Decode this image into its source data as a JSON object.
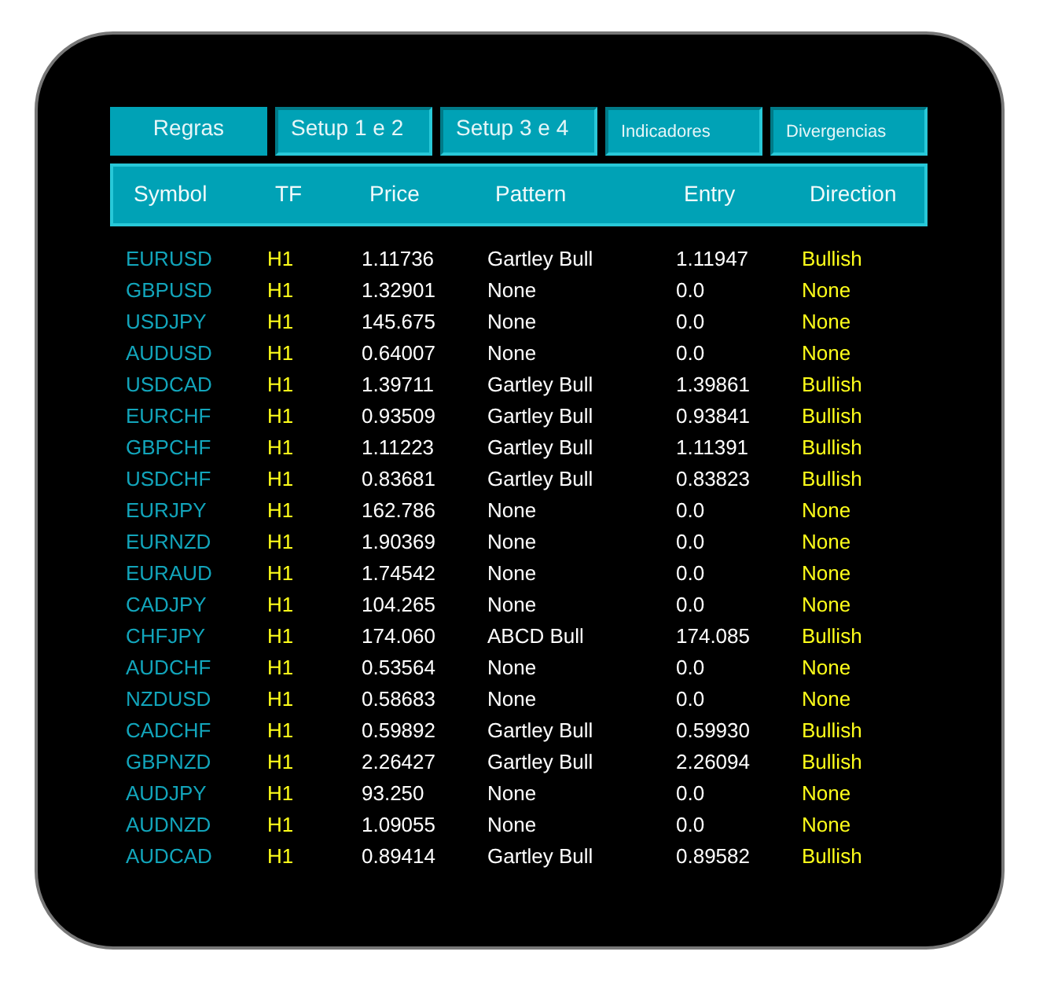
{
  "tabs": [
    {
      "label": "Regras",
      "selected": true,
      "kind": "large"
    },
    {
      "label": "Setup 1 e 2",
      "selected": false,
      "kind": "large"
    },
    {
      "label": "Setup 3 e 4",
      "selected": false,
      "kind": "large"
    },
    {
      "label": "Indicadores",
      "selected": false,
      "kind": "compact"
    },
    {
      "label": "Divergencias",
      "selected": false,
      "kind": "compact"
    }
  ],
  "table": {
    "columns": [
      "Symbol",
      "TF",
      "Price",
      "Pattern",
      "Entry",
      "Direction"
    ],
    "rows": [
      [
        "EURUSD",
        "H1",
        "1.11736",
        "Gartley Bull",
        "1.11947",
        "Bullish"
      ],
      [
        "GBPUSD",
        "H1",
        "1.32901",
        "None",
        "0.0",
        "None"
      ],
      [
        "USDJPY",
        "H1",
        "145.675",
        "None",
        "0.0",
        "None"
      ],
      [
        "AUDUSD",
        "H1",
        "0.64007",
        "None",
        "0.0",
        "None"
      ],
      [
        "USDCAD",
        "H1",
        "1.39711",
        "Gartley Bull",
        "1.39861",
        "Bullish"
      ],
      [
        "EURCHF",
        "H1",
        "0.93509",
        "Gartley Bull",
        "0.93841",
        "Bullish"
      ],
      [
        "GBPCHF",
        "H1",
        "1.11223",
        "Gartley Bull",
        "1.11391",
        "Bullish"
      ],
      [
        "USDCHF",
        "H1",
        "0.83681",
        "Gartley Bull",
        "0.83823",
        "Bullish"
      ],
      [
        "EURJPY",
        "H1",
        "162.786",
        "None",
        "0.0",
        "None"
      ],
      [
        "EURNZD",
        "H1",
        "1.90369",
        "None",
        "0.0",
        "None"
      ],
      [
        "EURAUD",
        "H1",
        "1.74542",
        "None",
        "0.0",
        "None"
      ],
      [
        "CADJPY",
        "H1",
        "104.265",
        "None",
        "0.0",
        "None"
      ],
      [
        "CHFJPY",
        "H1",
        "174.060",
        "ABCD Bull",
        "174.085",
        "Bullish"
      ],
      [
        "AUDCHF",
        "H1",
        "0.53564",
        "None",
        "0.0",
        "None"
      ],
      [
        "NZDUSD",
        "H1",
        "0.58683",
        "None",
        "0.0",
        "None"
      ],
      [
        "CADCHF",
        "H1",
        "0.59892",
        "Gartley Bull",
        "0.59930",
        "Bullish"
      ],
      [
        "GBPNZD",
        "H1",
        "2.26427",
        "Gartley Bull",
        "2.26094",
        "Bullish"
      ],
      [
        "AUDJPY",
        "H1",
        "93.250",
        "None",
        "0.0",
        "None"
      ],
      [
        "AUDNZD",
        "H1",
        "1.09055",
        "None",
        "0.0",
        "None"
      ],
      [
        "AUDCAD",
        "H1",
        "0.89414",
        "Gartley Bull",
        "0.89582",
        "Bullish"
      ]
    ]
  }
}
